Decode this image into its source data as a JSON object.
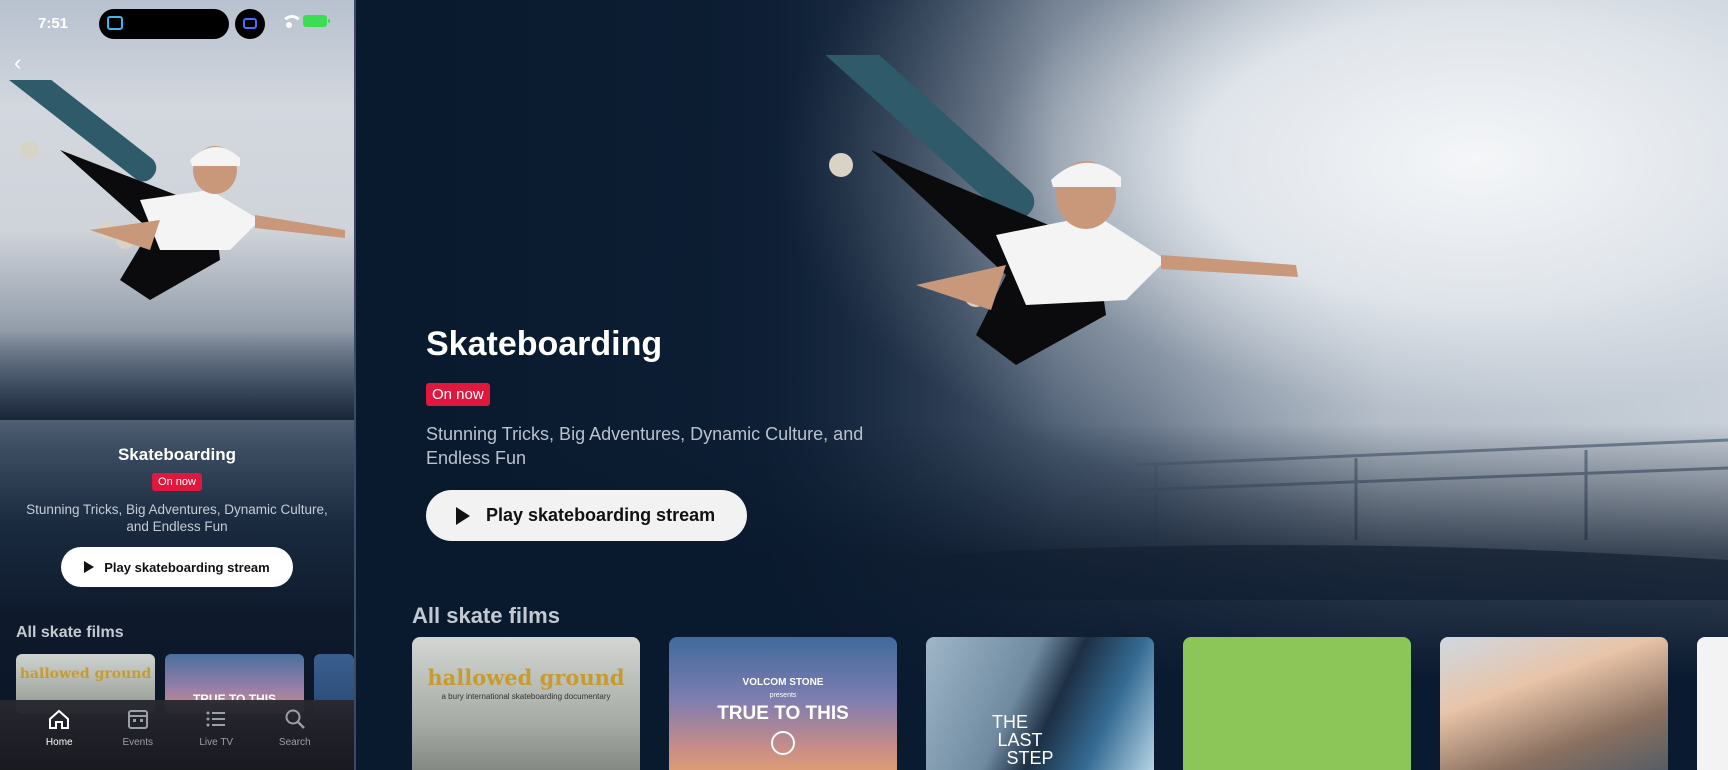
{
  "phone": {
    "status": {
      "time": "7:51"
    },
    "hero": {
      "title": "Skateboarding",
      "badge": "On now",
      "description": "Stunning Tricks, Big Adventures, Dynamic Culture, and Endless Fun",
      "play_label": "Play skateboarding stream"
    },
    "section_title": "All skate films",
    "thumbs": [
      {
        "title": "hallowed ground"
      },
      {
        "title": "TRUE TO THIS"
      }
    ],
    "tabbar": [
      {
        "label": "Home",
        "icon": "home-icon",
        "active": true
      },
      {
        "label": "Events",
        "icon": "calendar-icon",
        "active": false
      },
      {
        "label": "Live TV",
        "icon": "list-icon",
        "active": false
      },
      {
        "label": "Search",
        "icon": "search-icon",
        "active": false
      }
    ]
  },
  "tv": {
    "hero": {
      "title": "Skateboarding",
      "badge": "On now",
      "description": "Stunning Tricks, Big Adventures, Dynamic Culture, and Endless Fun",
      "play_label": "Play skateboarding stream"
    },
    "section_title": "All skate films",
    "cards": [
      {
        "title": "hallowed ground",
        "subtitle": "a bury international skateboarding documentary"
      },
      {
        "brand": "VOLCOM STONE",
        "presents": "presents",
        "title": "TRUE TO THIS"
      },
      {
        "title_line1": "THE",
        "title_line2": "LAST",
        "title_line3": "STEP"
      },
      {
        "title": ""
      },
      {
        "title": ""
      }
    ]
  },
  "colors": {
    "badge_red": "#e0183e",
    "button_bg": "#f2f2f2",
    "navy": "#0a1a30",
    "green_card": "#8cc659"
  }
}
